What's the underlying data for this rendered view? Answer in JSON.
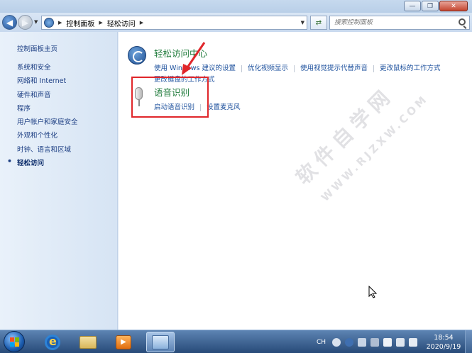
{
  "window": {
    "minimize_glyph": "—",
    "maximize_glyph": "❐",
    "close_glyph": "✕"
  },
  "address": {
    "breadcrumbs": [
      "控制面板",
      "轻松访问"
    ],
    "search_placeholder": "搜索控制面板"
  },
  "sidebar": {
    "home": "控制面板主页",
    "items": [
      {
        "label": "系统和安全"
      },
      {
        "label": "网络和 Internet"
      },
      {
        "label": "硬件和声音"
      },
      {
        "label": "程序"
      },
      {
        "label": "用户帐户和家庭安全"
      },
      {
        "label": "外观和个性化"
      },
      {
        "label": "时钟、语言和区域"
      },
      {
        "label": "轻松访问",
        "current": true
      }
    ]
  },
  "main": {
    "ease_center": {
      "title": "轻松访问中心",
      "links": [
        "使用 Windows 建议的设置",
        "优化视频显示",
        "使用视觉提示代替声音",
        "更改鼠标的工作方式"
      ],
      "links2": [
        "更改键盘的工作方式"
      ]
    },
    "speech": {
      "title": "语音识别",
      "links": [
        "启动语音识别",
        "设置麦克风"
      ]
    }
  },
  "watermark": {
    "main": "软件自学网",
    "sub": "WWW.RJZXW.COM"
  },
  "taskbar": {
    "language": "CH",
    "time": "18:54",
    "date": "2020/9/19"
  },
  "icons": {
    "back": "back-arrow-icon",
    "forward": "forward-arrow-icon",
    "refresh": "refresh-icon",
    "search": "search-icon",
    "ease": "ease-of-access-icon",
    "mic": "microphone-icon"
  },
  "colors": {
    "category_title": "#1e7a3a",
    "link": "#1b4f9c",
    "highlight": "#e0262a"
  }
}
